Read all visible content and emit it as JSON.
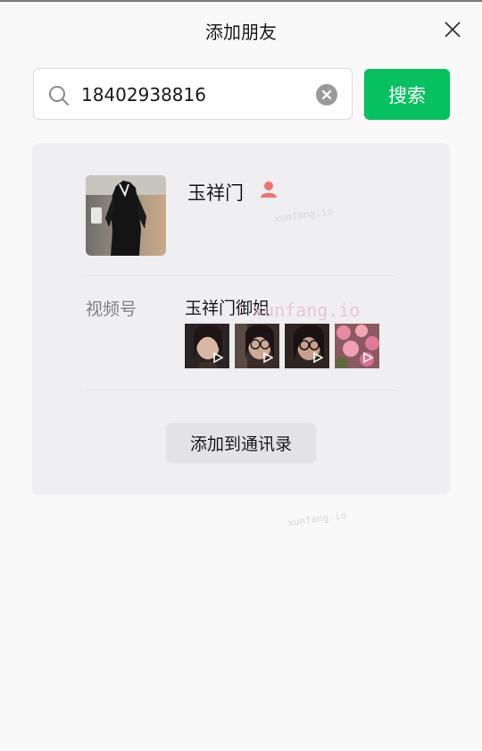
{
  "header": {
    "title": "添加朋友"
  },
  "search": {
    "value": "18402938816",
    "button_label": "搜索"
  },
  "result": {
    "name": "玉祥门",
    "gender": "female",
    "channels": {
      "label": "视频号",
      "name": "玉祥门御姐",
      "thumbnails": [
        "video-thumb-1",
        "video-thumb-2",
        "video-thumb-3",
        "video-thumb-4"
      ]
    },
    "add_button_label": "添加到通讯录"
  },
  "watermark": {
    "small_1": "xunfang.io",
    "large": "xunfang.io",
    "small_2": "xunfang.io"
  },
  "colors": {
    "accent": "#07c160",
    "gender_female": "#f0706f",
    "card_bg": "#efeff2"
  }
}
